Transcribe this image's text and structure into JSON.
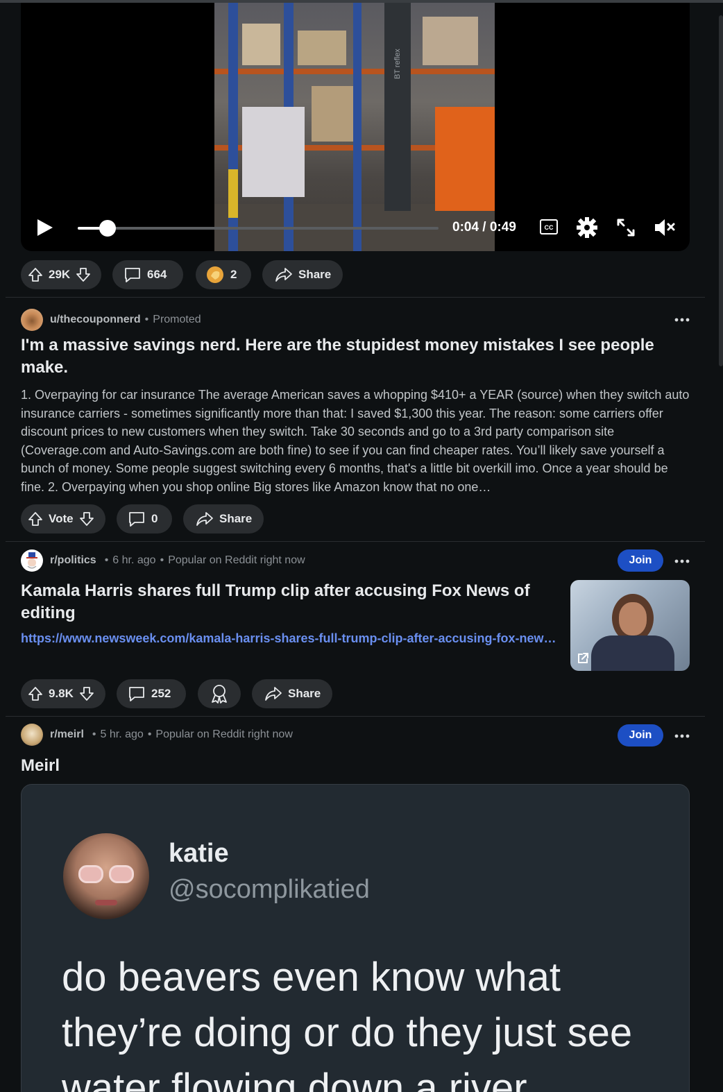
{
  "video": {
    "current_time": "0:04",
    "duration": "0:49",
    "time_display": "0:04 / 0:49",
    "progress_fraction": 0.082,
    "frame_label": "BT reflex"
  },
  "post1_actions": {
    "votes": "29K",
    "comments": "664",
    "awards": "2",
    "share": "Share"
  },
  "promoted": {
    "author": "u/thecouponnerd",
    "tag": "Promoted",
    "title": "I'm a massive savings nerd. Here are the stupidest money mistakes I see people make.",
    "body": "1. Overpaying for car insurance The average American saves a whopping $410+ a YEAR (source) when they switch auto insurance carriers - sometimes significantly more than that: I saved $1,300 this year. The reason: some carriers offer discount prices to new customers when they switch. Take 30 seconds and go to a 3rd party comparison site (Coverage.com and Auto-Savings.com are both fine) to see if you can find cheaper rates. You’ll likely save yourself a bunch of money. Some people suggest switching every 6 months, that's a little bit overkill imo. Once a year should be fine. 2. Overpaying when you shop online Big stores like Amazon know that no one…",
    "vote_label": "Vote",
    "comments": "0",
    "share": "Share"
  },
  "politics": {
    "subreddit": "r/politics",
    "time": "6 hr. ago",
    "context": "Popular on Reddit right now",
    "join": "Join",
    "title": "Kamala Harris shares full Trump clip after accusing Fox News of editing",
    "link": "https://www.newsweek.com/kamala-harris-shares-full-trump-clip-after-accusing-fox-news-of-editing",
    "votes": "9.8K",
    "comments": "252",
    "share": "Share"
  },
  "meirl": {
    "subreddit": "r/meirl",
    "time": "5 hr. ago",
    "context": "Popular on Reddit right now",
    "join": "Join",
    "title": "Meirl",
    "tweet_name": "katie",
    "tweet_handle": "@socomplikatied",
    "tweet_text": "do beavers even know what they’re doing or do they just see water flowing down a river"
  },
  "dot": "•",
  "colors": {
    "background": "#0e1113",
    "pill": "#2a2d30",
    "join": "#1d4fc4",
    "link": "#6a8ff0"
  }
}
